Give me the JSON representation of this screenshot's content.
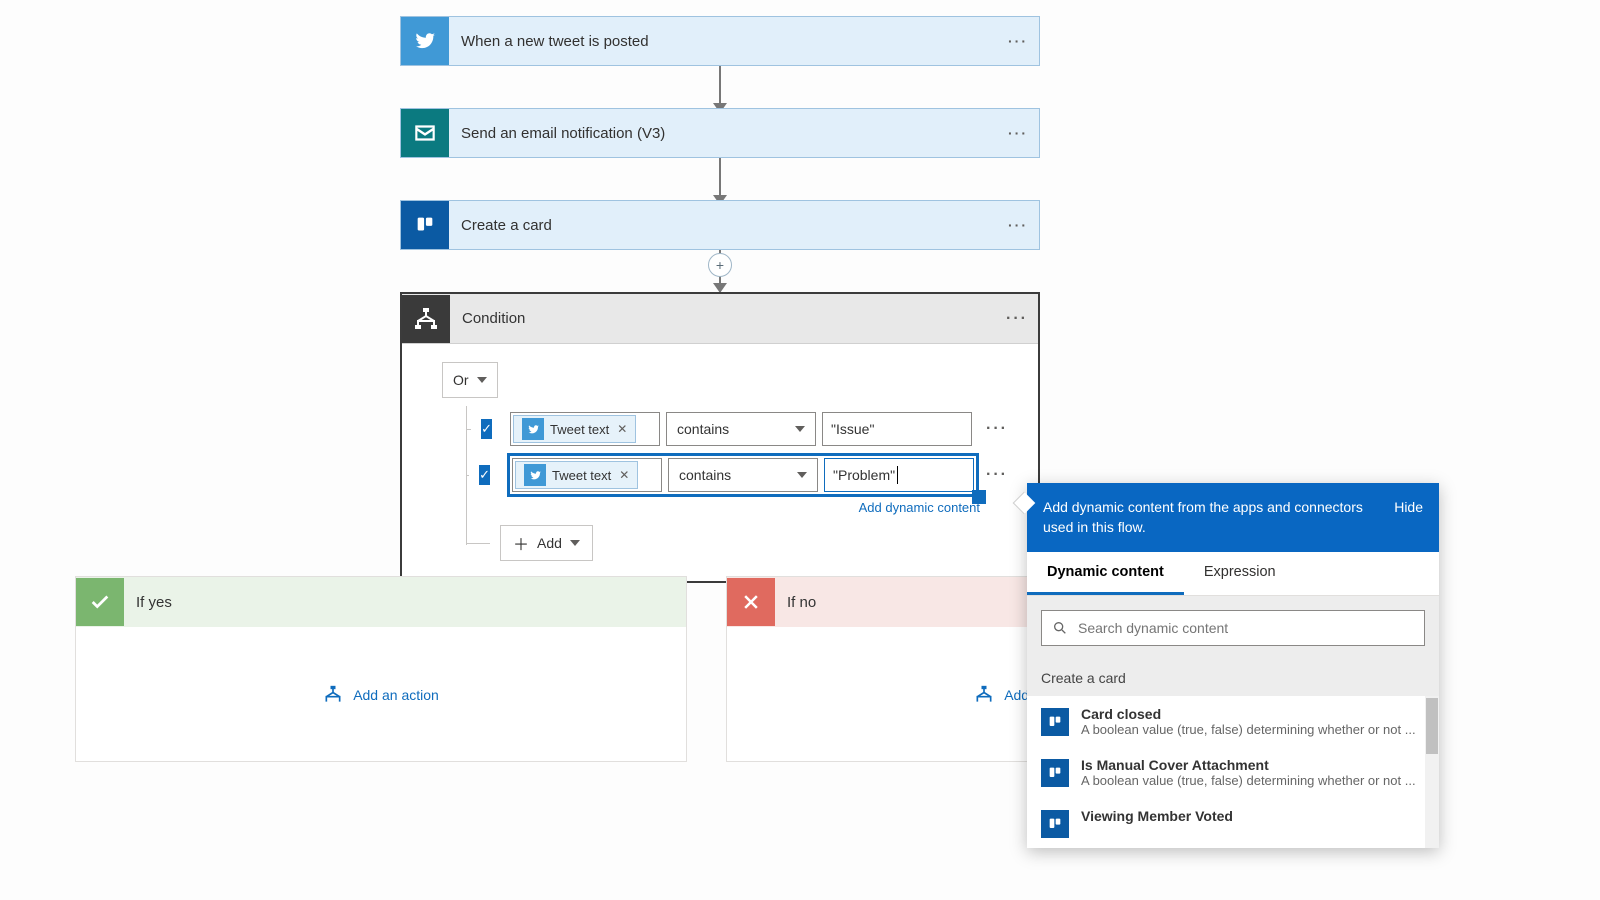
{
  "steps": [
    {
      "icon": "twitter",
      "title": "When a new tweet is posted"
    },
    {
      "icon": "mail",
      "title": "Send an email notification (V3)"
    },
    {
      "icon": "trello",
      "title": "Create a card"
    }
  ],
  "condition": {
    "title": "Condition",
    "group_op": "Or",
    "rows": [
      {
        "token": "Tweet text",
        "operator": "contains",
        "value": "\"Issue\""
      },
      {
        "token": "Tweet text",
        "operator": "contains",
        "value": "\"Problem\""
      }
    ],
    "add_label": "Add",
    "dyn_link": "Add dynamic content"
  },
  "branches": {
    "yes": {
      "title": "If yes",
      "action": "Add an action"
    },
    "no": {
      "title": "If no",
      "action": "Add an action"
    }
  },
  "dyn_panel": {
    "header": "Add dynamic content from the apps and connectors used in this flow.",
    "hide": "Hide",
    "tabs": {
      "dynamic": "Dynamic content",
      "expression": "Expression"
    },
    "search_placeholder": "Search dynamic content",
    "section": "Create a card",
    "items": [
      {
        "name": "Card closed",
        "desc": "A boolean value (true, false) determining whether or not ..."
      },
      {
        "name": "Is Manual Cover Attachment",
        "desc": "A boolean value (true, false) determining whether or not ..."
      },
      {
        "name": "Viewing Member Voted",
        "desc": ""
      }
    ]
  }
}
